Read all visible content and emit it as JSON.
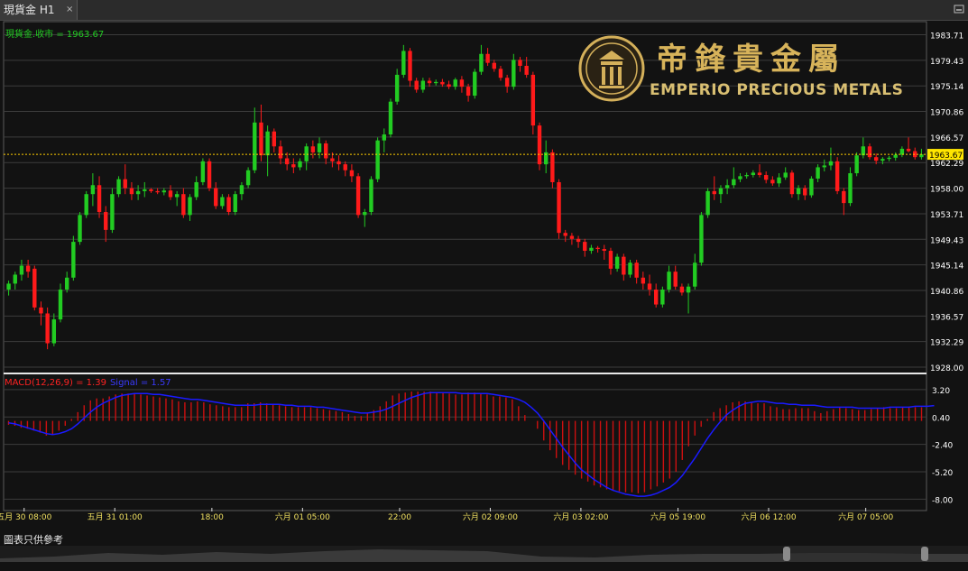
{
  "tab": {
    "title": "現貨金 H1",
    "close": "×"
  },
  "logo": {
    "cn": "帝鋒貴金屬",
    "en": "EMPERIO PRECIOUS METALS"
  },
  "disclaimer": "圖表只供參考",
  "colors": {
    "up": "#22cc22",
    "down": "#ff1a1a",
    "macd_hist": "#cc1010",
    "signal": "#1a1aff",
    "grid": "#3c3c3c",
    "price_line": "#ffcc00",
    "axis_text": "#ffffff"
  },
  "chart_data": [
    {
      "type": "candlestick",
      "title": "現貨金.收市 = 1963.67",
      "symbol": "現貨金",
      "timeframe": "H1",
      "last_close": 1963.67,
      "last_close_label": "1963.67",
      "ylim": [
        1928.0,
        1985.0
      ],
      "y_ticks": [
        "1983.71",
        "1979.43",
        "1975.14",
        "1970.86",
        "1966.57",
        "1962.29",
        "1958.00",
        "1953.71",
        "1949.43",
        "1945.14",
        "1940.86",
        "1936.57",
        "1932.29",
        "1928.00"
      ],
      "x_tick_labels": [
        "五月 30 08:00",
        "五月 31 01:00",
        "18:00",
        "六月 01 05:00",
        "22:00",
        "六月 02 09:00",
        "六月 03 02:00",
        "六月 05 19:00",
        "六月 06 12:00",
        "六月 07 05:00"
      ],
      "candles": [
        [
          1941.0,
          1942.5,
          1940.0,
          1942.0
        ],
        [
          1942.0,
          1944.0,
          1941.0,
          1943.5
        ],
        [
          1943.5,
          1946.0,
          1942.5,
          1945.0
        ],
        [
          1945.0,
          1946.0,
          1943.0,
          1944.0
        ],
        [
          1944.5,
          1945.0,
          1937.5,
          1938.0
        ],
        [
          1938.0,
          1939.0,
          1935.0,
          1937.0
        ],
        [
          1937.0,
          1938.0,
          1931.0,
          1932.0
        ],
        [
          1932.0,
          1937.0,
          1931.5,
          1936.0
        ],
        [
          1936.0,
          1942.0,
          1935.5,
          1941.0
        ],
        [
          1941.0,
          1944.0,
          1940.5,
          1943.0
        ],
        [
          1943.0,
          1950.0,
          1942.5,
          1949.0
        ],
        [
          1949.0,
          1954.0,
          1948.5,
          1953.5
        ],
        [
          1953.5,
          1957.5,
          1953.0,
          1957.0
        ],
        [
          1957.0,
          1960.5,
          1955.0,
          1958.5
        ],
        [
          1958.5,
          1960.0,
          1953.0,
          1954.0
        ],
        [
          1954.0,
          1955.0,
          1949.0,
          1951.0
        ],
        [
          1951.0,
          1958.0,
          1950.5,
          1957.0
        ],
        [
          1957.0,
          1960.0,
          1956.5,
          1959.5
        ],
        [
          1959.5,
          1962.0,
          1957.0,
          1958.0
        ],
        [
          1958.0,
          1959.0,
          1956.0,
          1957.0
        ],
        [
          1957.0,
          1958.5,
          1956.0,
          1957.5
        ],
        [
          1957.5,
          1959.0,
          1956.5,
          1957.8
        ],
        [
          1957.8,
          1958.0,
          1957.2,
          1957.5
        ],
        [
          1957.5,
          1958.0,
          1957.0,
          1957.3
        ],
        [
          1957.3,
          1958.0,
          1956.8,
          1957.6
        ],
        [
          1957.6,
          1958.5,
          1956.0,
          1956.5
        ],
        [
          1956.5,
          1957.5,
          1955.0,
          1957.0
        ],
        [
          1957.0,
          1958.0,
          1953.0,
          1953.5
        ],
        [
          1953.5,
          1957.0,
          1952.5,
          1956.5
        ],
        [
          1956.5,
          1960.0,
          1956.0,
          1959.0
        ],
        [
          1959.0,
          1963.0,
          1958.5,
          1962.5
        ],
        [
          1962.5,
          1963.0,
          1957.5,
          1958.0
        ],
        [
          1958.0,
          1959.0,
          1954.5,
          1955.0
        ],
        [
          1955.0,
          1957.0,
          1954.5,
          1956.5
        ],
        [
          1956.5,
          1957.0,
          1953.5,
          1954.0
        ],
        [
          1954.0,
          1957.5,
          1953.5,
          1957.0
        ],
        [
          1957.0,
          1959.0,
          1956.0,
          1958.5
        ],
        [
          1958.5,
          1961.5,
          1958.0,
          1961.0
        ],
        [
          1961.0,
          1971.5,
          1960.5,
          1969.0
        ],
        [
          1969.0,
          1972.0,
          1962.5,
          1963.5
        ],
        [
          1963.5,
          1968.5,
          1960.0,
          1967.5
        ],
        [
          1967.5,
          1968.0,
          1964.0,
          1965.0
        ],
        [
          1965.0,
          1966.0,
          1962.0,
          1963.0
        ],
        [
          1963.0,
          1964.0,
          1961.0,
          1962.0
        ],
        [
          1962.0,
          1963.0,
          1960.5,
          1961.5
        ],
        [
          1961.5,
          1963.0,
          1961.0,
          1962.5
        ],
        [
          1962.5,
          1965.5,
          1961.0,
          1965.0
        ],
        [
          1965.0,
          1966.0,
          1963.0,
          1964.0
        ],
        [
          1964.0,
          1966.5,
          1963.0,
          1965.5
        ],
        [
          1965.5,
          1966.0,
          1962.0,
          1963.0
        ],
        [
          1963.0,
          1964.0,
          1961.5,
          1962.5
        ],
        [
          1962.5,
          1963.5,
          1961.0,
          1962.0
        ],
        [
          1962.0,
          1962.5,
          1960.0,
          1961.0
        ],
        [
          1961.0,
          1962.0,
          1959.0,
          1960.0
        ],
        [
          1960.0,
          1960.5,
          1953.0,
          1953.5
        ],
        [
          1953.5,
          1954.5,
          1951.5,
          1954.0
        ],
        [
          1954.0,
          1960.0,
          1953.5,
          1959.5
        ],
        [
          1959.5,
          1966.5,
          1959.0,
          1966.0
        ],
        [
          1966.0,
          1968.0,
          1964.0,
          1967.0
        ],
        [
          1967.0,
          1973.0,
          1966.5,
          1972.5
        ],
        [
          1972.5,
          1978.0,
          1972.0,
          1977.0
        ],
        [
          1977.0,
          1982.0,
          1976.5,
          1981.0
        ],
        [
          1981.0,
          1981.5,
          1975.0,
          1976.0
        ],
        [
          1976.0,
          1976.5,
          1974.0,
          1974.5
        ],
        [
          1974.5,
          1976.5,
          1974.0,
          1976.0
        ],
        [
          1976.0,
          1976.5,
          1975.0,
          1975.6
        ],
        [
          1975.6,
          1976.2,
          1975.2,
          1975.8
        ],
        [
          1975.8,
          1976.3,
          1975.0,
          1975.4
        ],
        [
          1975.4,
          1976.0,
          1974.6,
          1975.0
        ],
        [
          1975.0,
          1976.5,
          1974.5,
          1976.2
        ],
        [
          1976.2,
          1976.8,
          1974.0,
          1975.0
        ],
        [
          1975.0,
          1975.5,
          1972.5,
          1973.5
        ],
        [
          1973.5,
          1978.0,
          1973.0,
          1977.5
        ],
        [
          1977.5,
          1982.0,
          1977.0,
          1980.5
        ],
        [
          1980.5,
          1981.5,
          1978.5,
          1979.0
        ],
        [
          1979.0,
          1979.5,
          1977.5,
          1978.0
        ],
        [
          1978.0,
          1978.5,
          1976.0,
          1976.5
        ],
        [
          1976.5,
          1977.0,
          1974.0,
          1975.0
        ],
        [
          1975.0,
          1980.5,
          1974.5,
          1979.5
        ],
        [
          1979.5,
          1980.0,
          1977.5,
          1978.5
        ],
        [
          1978.5,
          1980.0,
          1976.5,
          1977.0
        ],
        [
          1977.0,
          1977.5,
          1967.0,
          1968.5
        ],
        [
          1968.5,
          1969.0,
          1961.0,
          1962.0
        ],
        [
          1962.0,
          1966.0,
          1960.5,
          1964.0
        ],
        [
          1964.0,
          1964.5,
          1958.0,
          1959.0
        ],
        [
          1959.0,
          1959.5,
          1949.5,
          1950.5
        ],
        [
          1950.5,
          1951.0,
          1949.0,
          1950.0
        ],
        [
          1950.0,
          1950.5,
          1948.5,
          1949.5
        ],
        [
          1949.5,
          1950.0,
          1948.0,
          1949.0
        ],
        [
          1949.0,
          1949.5,
          1946.5,
          1947.5
        ],
        [
          1947.5,
          1948.5,
          1947.0,
          1948.0
        ],
        [
          1948.0,
          1948.3,
          1947.2,
          1947.8
        ],
        [
          1947.8,
          1948.5,
          1946.0,
          1947.5
        ],
        [
          1947.5,
          1948.0,
          1943.5,
          1944.5
        ],
        [
          1944.5,
          1947.0,
          1944.0,
          1946.5
        ],
        [
          1946.5,
          1947.0,
          1942.5,
          1943.5
        ],
        [
          1943.5,
          1946.0,
          1943.0,
          1945.5
        ],
        [
          1945.5,
          1946.0,
          1942.0,
          1943.0
        ],
        [
          1943.0,
          1944.0,
          1941.0,
          1942.0
        ],
        [
          1942.0,
          1943.5,
          1940.0,
          1941.0
        ],
        [
          1941.0,
          1942.0,
          1938.0,
          1938.5
        ],
        [
          1938.5,
          1941.5,
          1938.0,
          1941.0
        ],
        [
          1941.0,
          1945.0,
          1940.5,
          1944.0
        ],
        [
          1944.0,
          1945.0,
          1941.0,
          1941.5
        ],
        [
          1941.5,
          1942.0,
          1940.0,
          1940.5
        ],
        [
          1940.5,
          1942.0,
          1937.0,
          1941.5
        ],
        [
          1941.5,
          1947.0,
          1941.0,
          1945.5
        ],
        [
          1945.5,
          1954.0,
          1945.0,
          1953.5
        ],
        [
          1953.5,
          1958.0,
          1953.0,
          1957.5
        ],
        [
          1957.5,
          1960.0,
          1956.0,
          1957.0
        ],
        [
          1957.0,
          1958.5,
          1955.5,
          1958.0
        ],
        [
          1958.0,
          1959.5,
          1957.0,
          1958.5
        ],
        [
          1958.5,
          1961.5,
          1958.0,
          1959.5
        ],
        [
          1959.5,
          1960.5,
          1959.0,
          1960.0
        ],
        [
          1960.0,
          1960.6,
          1959.6,
          1960.2
        ],
        [
          1960.2,
          1961.0,
          1959.8,
          1960.6
        ],
        [
          1960.6,
          1962.0,
          1959.8,
          1960.2
        ],
        [
          1960.2,
          1960.8,
          1958.8,
          1959.4
        ],
        [
          1959.4,
          1960.0,
          1958.4,
          1958.8
        ],
        [
          1958.8,
          1960.5,
          1958.2,
          1959.8
        ],
        [
          1959.8,
          1961.5,
          1959.4,
          1960.6
        ],
        [
          1960.6,
          1961.0,
          1956.4,
          1957.0
        ],
        [
          1957.0,
          1958.5,
          1956.0,
          1958.0
        ],
        [
          1958.0,
          1958.5,
          1956.0,
          1956.8
        ],
        [
          1956.8,
          1960.0,
          1956.4,
          1959.6
        ],
        [
          1959.6,
          1962.0,
          1959.0,
          1961.5
        ],
        [
          1961.5,
          1962.8,
          1960.8,
          1961.8
        ],
        [
          1961.8,
          1964.8,
          1961.0,
          1962.5
        ],
        [
          1962.5,
          1963.2,
          1957.0,
          1957.5
        ],
        [
          1957.5,
          1958.0,
          1953.5,
          1955.5
        ],
        [
          1955.5,
          1961.5,
          1955.0,
          1960.5
        ],
        [
          1960.5,
          1964.0,
          1960.0,
          1963.5
        ],
        [
          1963.5,
          1966.5,
          1963.0,
          1965.0
        ],
        [
          1965.0,
          1965.5,
          1962.8,
          1963.2
        ],
        [
          1963.2,
          1963.8,
          1962.0,
          1962.6
        ],
        [
          1962.6,
          1963.2,
          1962.0,
          1962.9
        ],
        [
          1962.9,
          1963.4,
          1962.5,
          1963.1
        ],
        [
          1963.1,
          1964.0,
          1962.6,
          1963.6
        ],
        [
          1963.6,
          1965.0,
          1963.2,
          1964.6
        ],
        [
          1964.6,
          1966.5,
          1964.0,
          1964.2
        ],
        [
          1964.2,
          1964.8,
          1962.8,
          1963.2
        ],
        [
          1963.2,
          1964.6,
          1962.8,
          1963.67
        ]
      ]
    },
    {
      "type": "macd",
      "title": "MACD(12,26,9) = 1.39",
      "signal_label": "Signal = 1.57",
      "params": [
        12,
        26,
        9
      ],
      "value": 1.39,
      "signal_value": 1.57,
      "ylim": [
        -8.8,
        4.3
      ],
      "y_ticks": [
        "3.20",
        "0.40",
        "-2.40",
        "-5.20",
        "-8.00"
      ],
      "histogram": [
        -0.4,
        -0.5,
        -0.7,
        -0.8,
        -1.0,
        -1.2,
        -1.5,
        -1.4,
        -1.0,
        -0.5,
        0.2,
        0.9,
        1.6,
        2.1,
        2.3,
        2.3,
        2.5,
        2.7,
        2.8,
        2.8,
        2.8,
        2.7,
        2.6,
        2.5,
        2.4,
        2.3,
        2.2,
        2.0,
        1.9,
        1.9,
        2.0,
        1.9,
        1.7,
        1.6,
        1.5,
        1.4,
        1.4,
        1.4,
        1.8,
        1.8,
        1.9,
        1.8,
        1.7,
        1.6,
        1.5,
        1.4,
        1.4,
        1.4,
        1.4,
        1.3,
        1.2,
        1.1,
        1.0,
        0.9,
        0.7,
        0.5,
        0.5,
        0.8,
        1.1,
        1.5,
        2.0,
        2.6,
        2.8,
        2.9,
        3.0,
        3.0,
        3.0,
        3.0,
        2.9,
        2.9,
        2.8,
        2.7,
        2.7,
        2.9,
        2.9,
        2.8,
        2.7,
        2.5,
        2.5,
        2.4,
        2.2,
        1.5,
        0.6,
        0.0,
        -0.8,
        -2.0,
        -3.0,
        -3.8,
        -4.5,
        -5.0,
        -5.5,
        -5.9,
        -6.2,
        -6.6,
        -6.8,
        -7.0,
        -7.1,
        -7.2,
        -7.3,
        -7.3,
        -7.4,
        -7.3,
        -7.0,
        -6.7,
        -6.3,
        -5.9,
        -5.2,
        -4.0,
        -2.6,
        -1.5,
        -0.6,
        0.2,
        0.9,
        1.3,
        1.6,
        1.9,
        2.0,
        2.0,
        1.9,
        1.8,
        1.8,
        1.5,
        1.4,
        1.2,
        1.2,
        1.3,
        1.3,
        1.3,
        1.0,
        0.8,
        1.0,
        1.2,
        1.4,
        1.3,
        1.2,
        1.1,
        1.1,
        1.2,
        1.3,
        1.4,
        1.3,
        1.3,
        1.4,
        1.4,
        1.4,
        1.39
      ],
      "signal": [
        -0.2,
        -0.3,
        -0.5,
        -0.7,
        -0.9,
        -1.1,
        -1.3,
        -1.4,
        -1.3,
        -1.1,
        -0.8,
        -0.3,
        0.3,
        0.9,
        1.4,
        1.8,
        2.1,
        2.4,
        2.6,
        2.7,
        2.8,
        2.8,
        2.8,
        2.7,
        2.7,
        2.6,
        2.5,
        2.4,
        2.3,
        2.2,
        2.2,
        2.1,
        2.0,
        1.9,
        1.8,
        1.7,
        1.6,
        1.6,
        1.6,
        1.6,
        1.7,
        1.7,
        1.7,
        1.7,
        1.6,
        1.6,
        1.5,
        1.5,
        1.5,
        1.4,
        1.4,
        1.3,
        1.2,
        1.1,
        1.0,
        0.9,
        0.8,
        0.8,
        0.9,
        1.0,
        1.2,
        1.5,
        1.8,
        2.1,
        2.4,
        2.6,
        2.8,
        2.9,
        2.9,
        2.9,
        2.9,
        2.9,
        2.8,
        2.8,
        2.8,
        2.8,
        2.8,
        2.7,
        2.6,
        2.5,
        2.4,
        2.2,
        1.9,
        1.4,
        0.8,
        0.0,
        -0.9,
        -1.8,
        -2.7,
        -3.5,
        -4.3,
        -5.0,
        -5.5,
        -6.0,
        -6.4,
        -6.8,
        -7.1,
        -7.3,
        -7.5,
        -7.6,
        -7.7,
        -7.7,
        -7.6,
        -7.4,
        -7.1,
        -6.8,
        -6.3,
        -5.6,
        -4.7,
        -3.8,
        -2.8,
        -1.8,
        -0.9,
        -0.1,
        0.6,
        1.1,
        1.5,
        1.8,
        1.9,
        2.0,
        2.0,
        1.9,
        1.8,
        1.8,
        1.7,
        1.7,
        1.6,
        1.6,
        1.6,
        1.5,
        1.4,
        1.4,
        1.4,
        1.4,
        1.4,
        1.3,
        1.3,
        1.3,
        1.3,
        1.3,
        1.4,
        1.4,
        1.4,
        1.4,
        1.5,
        1.5,
        1.5,
        1.57
      ]
    }
  ]
}
